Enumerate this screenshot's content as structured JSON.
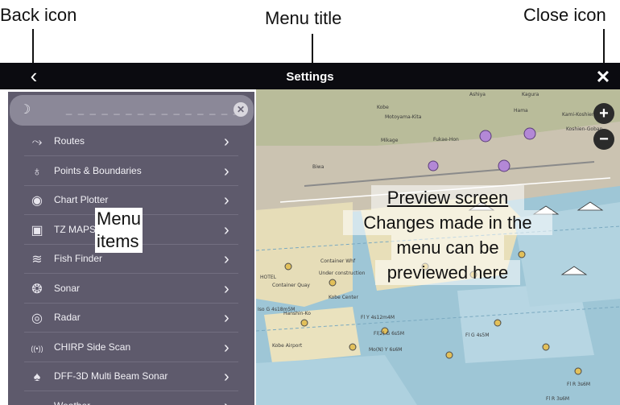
{
  "callouts": {
    "back_icon": "Back icon",
    "menu_title": "Menu title",
    "close_icon": "Close icon",
    "menu_items_line1": "Menu",
    "menu_items_line2": "items",
    "preview_title": "Preview screen",
    "preview_line1": "Changes made in the",
    "preview_line2": "menu can be",
    "preview_line3": "previewed here"
  },
  "topbar": {
    "title": "Settings",
    "back_glyph": "‹",
    "close_glyph": "✕"
  },
  "search": {
    "placeholder": "_ _ _ _ _ _ _ _ _ _ _ _ _ _ _"
  },
  "menu": {
    "items": [
      {
        "label": "Routes",
        "icon": "routes-icon",
        "glyph": "⤳"
      },
      {
        "label": "Points & Boundaries",
        "icon": "points-icon",
        "glyph": "♁"
      },
      {
        "label": "Chart Plotter",
        "icon": "chart-plotter-icon",
        "glyph": "◉"
      },
      {
        "label": "TZ MAPS",
        "icon": "tz-maps-icon",
        "glyph": "▣"
      },
      {
        "label": "Fish Finder",
        "icon": "fish-finder-icon",
        "glyph": "≋"
      },
      {
        "label": "Sonar",
        "icon": "sonar-icon",
        "glyph": "❂"
      },
      {
        "label": "Radar",
        "icon": "radar-icon",
        "glyph": "◎"
      },
      {
        "label": "CHIRP Side Scan",
        "icon": "chirp-icon",
        "glyph": "((•))"
      },
      {
        "label": "DFF-3D Multi Beam Sonar",
        "icon": "dff3d-icon",
        "glyph": "♠"
      },
      {
        "label": "Weather",
        "icon": "weather-icon",
        "glyph": "☁"
      }
    ]
  },
  "map": {
    "labels": [
      "Kobe",
      "Ashiya",
      "Kagura",
      "Motoyama-Kita",
      "Hama",
      "Kami-Koshien",
      "Koshien-Goban",
      "Mikage",
      "Fukae-Hon",
      "Biwa",
      "Hanshin-Ko",
      "Container Whf",
      "Container Quay",
      "HOTEL",
      "Under construction",
      "Kobe Center",
      "Iso G 4s18m5M",
      "Fl Y 4s12m4M",
      "Fl(2) G 6s5M",
      "Fl G 4s5M",
      "Mo(N) Y 6s6M",
      "Kobe Airport",
      "Fl R 3s6M",
      "Fl R 3s6M"
    ],
    "zoom_in": "+",
    "zoom_out": "−"
  }
}
